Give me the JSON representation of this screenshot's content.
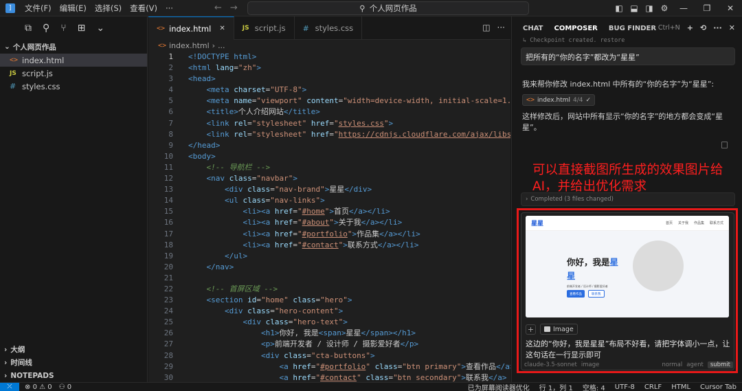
{
  "titlebar": {
    "menus": [
      "文件(F)",
      "编辑(E)",
      "选择(S)",
      "查看(V)",
      "···"
    ],
    "search_text": "个人网页作品"
  },
  "sidebar": {
    "folder": "个人网页作品",
    "files": [
      {
        "icon": "<>",
        "name": "index.html",
        "type": "html"
      },
      {
        "icon": "JS",
        "name": "script.js",
        "type": "js"
      },
      {
        "icon": "#",
        "name": "styles.css",
        "type": "css"
      }
    ],
    "bottom_sections": [
      "大纲",
      "时间线",
      "NOTEPADS"
    ]
  },
  "editor": {
    "tabs": [
      {
        "icon": "<>",
        "label": "index.html",
        "active": true
      },
      {
        "icon": "JS",
        "label": "script.js",
        "active": false
      },
      {
        "icon": "#",
        "label": "styles.css",
        "active": false
      }
    ],
    "breadcrumb": [
      "index.html",
      "..."
    ],
    "lines": [
      {
        "n": "1",
        "html": "<span class='t-tag'>&lt;!DOCTYPE html&gt;</span>"
      },
      {
        "n": "2",
        "html": "<span class='t-tag'>&lt;html</span> <span class='t-attr'>lang</span>=<span class='t-str'>\"zh\"</span><span class='t-tag'>&gt;</span>"
      },
      {
        "n": "3",
        "html": "<span class='t-tag'>&lt;head&gt;</span>"
      },
      {
        "n": "4",
        "html": "    <span class='t-tag'>&lt;meta</span> <span class='t-attr'>charset</span>=<span class='t-str'>\"UTF-8\"</span><span class='t-tag'>&gt;</span>"
      },
      {
        "n": "5",
        "html": "    <span class='t-tag'>&lt;meta</span> <span class='t-attr'>name</span>=<span class='t-str'>\"viewport\"</span> <span class='t-attr'>content</span>=<span class='t-str'>\"width=device-width, initial-scale=1.0</span>"
      },
      {
        "n": "6",
        "html": "    <span class='t-tag'>&lt;title&gt;</span>个人介绍网站<span class='t-tag'>&lt;/title&gt;</span>"
      },
      {
        "n": "7",
        "html": "    <span class='t-tag'>&lt;link</span> <span class='t-attr'>rel</span>=<span class='t-str'>\"stylesheet\"</span> <span class='t-attr'>href</span>=<span class='t-str'>\"</span><span class='t-link'>styles.css</span><span class='t-str'>\"</span><span class='t-tag'>&gt;</span>"
      },
      {
        "n": "8",
        "html": "    <span class='t-tag'>&lt;link</span> <span class='t-attr'>rel</span>=<span class='t-str'>\"stylesheet\"</span> <span class='t-attr'>href</span>=<span class='t-str'>\"</span><span class='t-link'>https://cdnjs.cloudflare.com/ajax/libs/</span>"
      },
      {
        "n": "9",
        "html": "<span class='t-tag'>&lt;/head&gt;</span>"
      },
      {
        "n": "10",
        "html": "<span class='t-tag'>&lt;body&gt;</span>"
      },
      {
        "n": "11",
        "html": "    <span class='t-com'>&lt;!-- 导航栏 --&gt;</span>"
      },
      {
        "n": "12",
        "html": "    <span class='t-tag'>&lt;nav</span> <span class='t-attr'>class</span>=<span class='t-str'>\"navbar\"</span><span class='t-tag'>&gt;</span>"
      },
      {
        "n": "13",
        "html": "        <span class='t-tag'>&lt;div</span> <span class='t-attr'>class</span>=<span class='t-str'>\"nav-brand\"</span><span class='t-tag'>&gt;</span>星星<span class='t-tag'>&lt;/div&gt;</span>"
      },
      {
        "n": "14",
        "html": "        <span class='t-tag'>&lt;ul</span> <span class='t-attr'>class</span>=<span class='t-str'>\"nav-links\"</span><span class='t-tag'>&gt;</span>"
      },
      {
        "n": "15",
        "html": "            <span class='t-tag'>&lt;li&gt;&lt;a</span> <span class='t-attr'>href</span>=<span class='t-str'>\"</span><span class='t-link'>#home</span><span class='t-str'>\"</span><span class='t-tag'>&gt;</span>首页<span class='t-tag'>&lt;/a&gt;&lt;/li&gt;</span>"
      },
      {
        "n": "16",
        "html": "            <span class='t-tag'>&lt;li&gt;&lt;a</span> <span class='t-attr'>href</span>=<span class='t-str'>\"</span><span class='t-link'>#about</span><span class='t-str'>\"</span><span class='t-tag'>&gt;</span>关于我<span class='t-tag'>&lt;/a&gt;&lt;/li&gt;</span>"
      },
      {
        "n": "17",
        "html": "            <span class='t-tag'>&lt;li&gt;&lt;a</span> <span class='t-attr'>href</span>=<span class='t-str'>\"</span><span class='t-link'>#portfolio</span><span class='t-str'>\"</span><span class='t-tag'>&gt;</span>作品集<span class='t-tag'>&lt;/a&gt;&lt;/li&gt;</span>"
      },
      {
        "n": "18",
        "html": "            <span class='t-tag'>&lt;li&gt;&lt;a</span> <span class='t-attr'>href</span>=<span class='t-str'>\"</span><span class='t-link'>#contact</span><span class='t-str'>\"</span><span class='t-tag'>&gt;</span>联系方式<span class='t-tag'>&lt;/a&gt;&lt;/li&gt;</span>"
      },
      {
        "n": "19",
        "html": "        <span class='t-tag'>&lt;/ul&gt;</span>"
      },
      {
        "n": "20",
        "html": "    <span class='t-tag'>&lt;/nav&gt;</span>"
      },
      {
        "n": "21",
        "html": ""
      },
      {
        "n": "22",
        "html": "    <span class='t-com'>&lt;!-- 首屏区域 --&gt;</span>"
      },
      {
        "n": "23",
        "html": "    <span class='t-tag'>&lt;section</span> <span class='t-attr'>id</span>=<span class='t-str'>\"home\"</span> <span class='t-attr'>class</span>=<span class='t-str'>\"hero\"</span><span class='t-tag'>&gt;</span>"
      },
      {
        "n": "24",
        "html": "        <span class='t-tag'>&lt;div</span> <span class='t-attr'>class</span>=<span class='t-str'>\"hero-content\"</span><span class='t-tag'>&gt;</span>"
      },
      {
        "n": "25",
        "html": "            <span class='t-tag'>&lt;div</span> <span class='t-attr'>class</span>=<span class='t-str'>\"hero-text\"</span><span class='t-tag'>&gt;</span>"
      },
      {
        "n": "26",
        "html": "                <span class='t-tag'>&lt;h1&gt;</span>你好, 我是<span class='t-tag'>&lt;span&gt;</span>星星<span class='t-tag'>&lt;/span&gt;&lt;/h1&gt;</span>"
      },
      {
        "n": "27",
        "html": "                <span class='t-tag'>&lt;p&gt;</span>前端开发者 / 设计师 / 摄影爱好者<span class='t-tag'>&lt;/p&gt;</span>"
      },
      {
        "n": "28",
        "html": "                <span class='t-tag'>&lt;div</span> <span class='t-attr'>class</span>=<span class='t-str'>\"cta-buttons\"</span><span class='t-tag'>&gt;</span>"
      },
      {
        "n": "29",
        "html": "                    <span class='t-tag'>&lt;a</span> <span class='t-attr'>href</span>=<span class='t-str'>\"</span><span class='t-link'>#portfolio</span><span class='t-str'>\"</span> <span class='t-attr'>class</span>=<span class='t-str'>\"btn primary\"</span><span class='t-tag'>&gt;</span>查看作品<span class='t-tag'>&lt;/a&gt;</span>"
      },
      {
        "n": "30",
        "html": "                    <span class='t-tag'>&lt;a</span> <span class='t-attr'>href</span>=<span class='t-str'>\"</span><span class='t-link'>#contact</span><span class='t-str'>\"</span> <span class='t-attr'>class</span>=<span class='t-str'>\"btn secondary\"</span><span class='t-tag'>&gt;</span>联系我<span class='t-tag'>&lt;/a&gt;</span>"
      }
    ]
  },
  "panel": {
    "tabs": [
      "CHAT",
      "COMPOSER",
      "BUG FINDER"
    ],
    "shortcut": "Ctrl+N",
    "checkpoint": "Checkpoint created. restore",
    "user_message": "把所有的“你的名字”都改为“星星”",
    "ai_intro": "我来帮你修改 index.html 中所有的“你的名字”为“星星”:",
    "file_chip": {
      "name": "index.html",
      "count": "4/4"
    },
    "ai_result": "这样修改后，网站中所有显示“你的名字”的地方都会变成“星星”。",
    "annotation": "可以直接截图所生成的效果图片给AI，并给出优化需求",
    "completed": "Completed (3 files changed)",
    "preview": {
      "brand": "星星",
      "links": [
        "首页",
        "关于我",
        "作品集",
        "联系方式"
      ],
      "title_prefix": "你好，我是",
      "title_name": "星星",
      "subtitle": "前端开发者 / 设计师 / 摄影爱好者",
      "btn_primary": "查看作品",
      "btn_secondary": "联系我"
    },
    "image_chip": "Image",
    "prompt": "这边的“你好，我是星星”布局不好看，请把字体调小一点，让这句话在一行显示即可",
    "footer": {
      "model": "claude-3.5-sonnet",
      "image": "image",
      "mode": "normal",
      "agent": "agent",
      "submit": "submit"
    }
  },
  "statusbar": {
    "errors": "0",
    "warnings": "0",
    "ports": "0",
    "items": [
      "已为屏幕阅读器优化",
      "行 1，列 1",
      "空格: 4",
      "UTF-8",
      "CRLF",
      "HTML",
      "Cursor Tab"
    ]
  }
}
